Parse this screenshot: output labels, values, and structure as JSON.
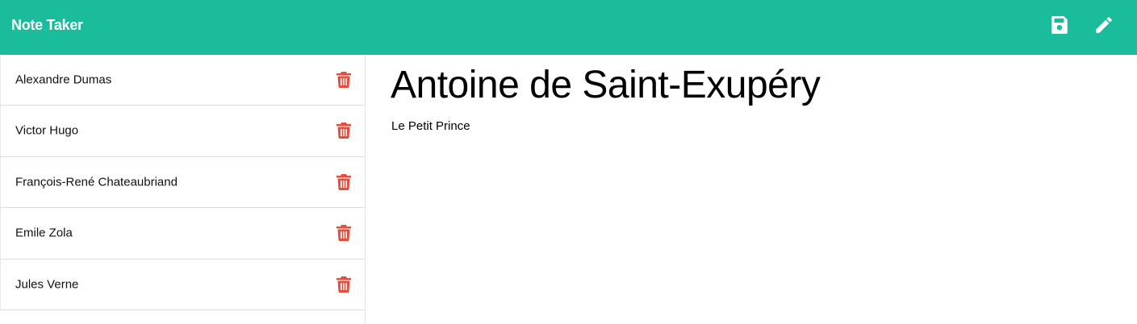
{
  "navbar": {
    "brand": "Note Taker",
    "background": "#1abc9c",
    "icons": [
      "save-icon",
      "pencil-icon"
    ]
  },
  "notes": [
    {
      "title": "Alexandre Dumas",
      "icon": "trash-icon"
    },
    {
      "title": "Victor Hugo",
      "icon": "trash-icon"
    },
    {
      "title": "François-René Chateaubriand",
      "icon": "trash-icon"
    },
    {
      "title": "Emile Zola",
      "icon": "trash-icon"
    },
    {
      "title": "Jules Verne",
      "icon": "trash-icon"
    }
  ],
  "active_note": {
    "title": "Antoine de Saint-Exupéry",
    "text": "Le Petit Prince"
  },
  "colors": {
    "accent": "#1abc9c",
    "delete": "#e74c3c"
  }
}
